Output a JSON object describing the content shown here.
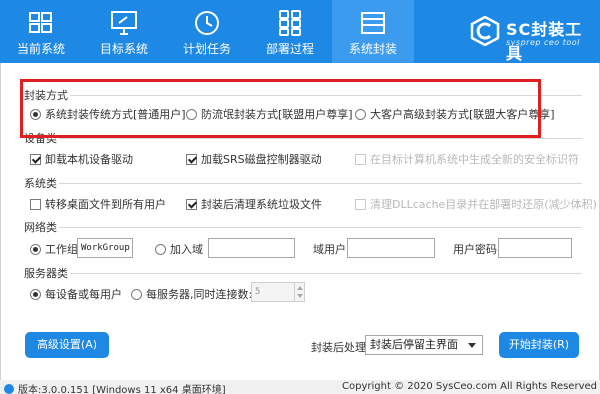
{
  "tabs": [
    {
      "label": "当前系统",
      "icon": "monitor-grid-icon"
    },
    {
      "label": "目标系统",
      "icon": "monitor-tool-icon"
    },
    {
      "label": "计划任务",
      "icon": "clock-icon"
    },
    {
      "label": "部署过程",
      "icon": "apps-grid-icon"
    },
    {
      "label": "系统封装",
      "icon": "drive-box-icon"
    }
  ],
  "active_tab": "系统封装",
  "brand": {
    "name": "SC封装工具",
    "subtitle": "sysprep ceo tool",
    "logo": "sc-logo-icon"
  },
  "seal_mode": {
    "title": "封装方式",
    "options": [
      {
        "label": "系统封装传统方式[普通用户]",
        "checked": true
      },
      {
        "label": "防流氓封装方式[联盟用户尊享]",
        "checked": false
      },
      {
        "label": "大客户高级封装方式[联盟大客户尊享]",
        "checked": false
      }
    ]
  },
  "device": {
    "title": "设备类",
    "options": [
      {
        "label": "卸载本机设备驱动",
        "checked": true,
        "enabled": true
      },
      {
        "label": "加载SRS磁盘控制器驱动",
        "checked": true,
        "enabled": true
      },
      {
        "label": "在目标计算机系统中生成全新的安全标识符",
        "checked": false,
        "enabled": false
      }
    ]
  },
  "system": {
    "title": "系统类",
    "options": [
      {
        "label": "转移桌面文件到所有用户",
        "checked": false,
        "enabled": true
      },
      {
        "label": "封装后清理系统垃圾文件",
        "checked": true,
        "enabled": true
      },
      {
        "label": "清理DLLcache目录并在部署时还原(减少体积)",
        "checked": false,
        "enabled": false
      }
    ]
  },
  "network": {
    "title": "网络类",
    "workgroup_label": "工作组",
    "workgroup_value": "WorkGroup",
    "join_domain_label": "加入域",
    "domain_user_label": "域用户:",
    "user_password_label": "用户密码:"
  },
  "server": {
    "title": "服务器类",
    "per_device_label": "每设备或每用户",
    "per_server_label": "每服务器,同时连接数:",
    "connections_value": "5"
  },
  "bottom": {
    "advanced_button": "高级设置(A)",
    "post_process_label": "封装后处理:",
    "post_process_value": "封装后停留主界面",
    "start_button": "开始封装(R)"
  },
  "status": {
    "version": "版本:3.0.0.151 [Windows 11 x64 桌面环境]",
    "copyright": "Copyright © 2020 SysCeo.com All Rights Reserved"
  },
  "colors": {
    "brand_blue": "#1e88e5",
    "highlight_red": "#e02020"
  }
}
